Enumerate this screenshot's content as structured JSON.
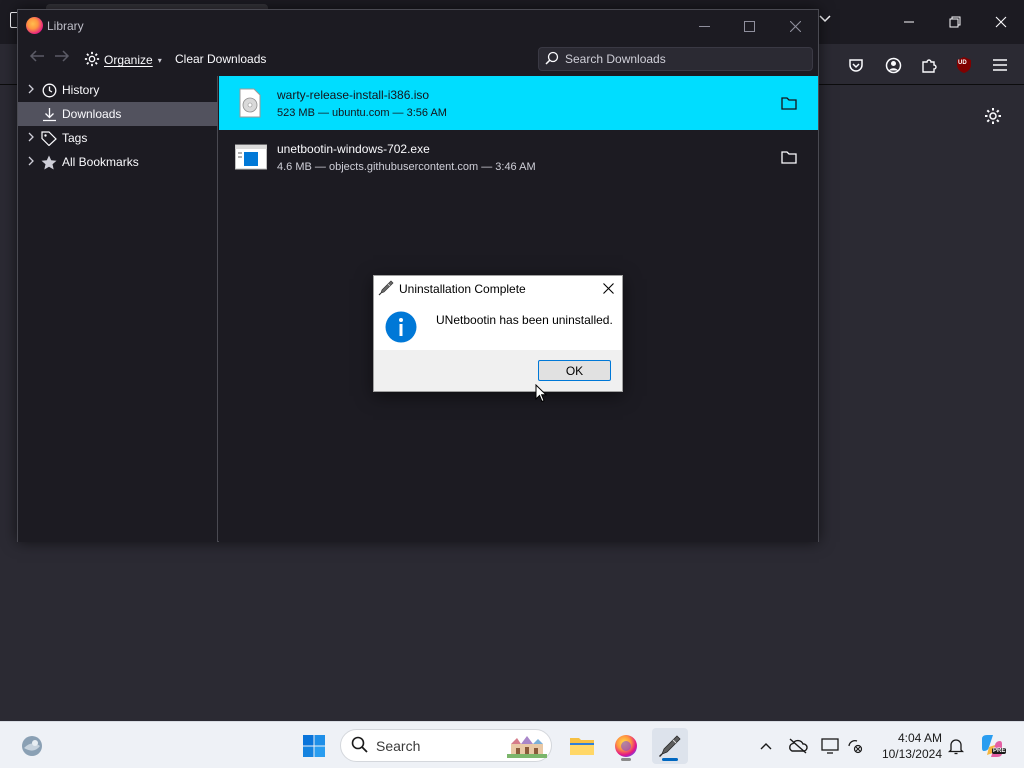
{
  "browser": {
    "toolbar_icons": [
      "pocket-icon",
      "account-icon",
      "extensions-icon",
      "ublock-icon",
      "menu-icon"
    ],
    "ublock_badge": "UD",
    "colors": {
      "background": "#2b2a33",
      "titlebar": "#1c1b22"
    }
  },
  "library": {
    "title": "Library",
    "toolbar": {
      "organize_label": "Organize",
      "clear_downloads_label": "Clear Downloads",
      "search_placeholder": "Search Downloads"
    },
    "sidebar": {
      "items": [
        {
          "label": "History",
          "icon": "clock-icon",
          "expandable": true,
          "selected": false
        },
        {
          "label": "Downloads",
          "icon": "download-icon",
          "expandable": false,
          "selected": true
        },
        {
          "label": "Tags",
          "icon": "tag-icon",
          "expandable": true,
          "selected": false
        },
        {
          "label": "All Bookmarks",
          "icon": "star-icon",
          "expandable": true,
          "selected": false
        }
      ]
    },
    "downloads": [
      {
        "name": "warty-release-install-i386.iso",
        "meta": "523 MB — ubuntu.com — 3:56 AM",
        "icon": "disc-image-icon",
        "selected": true
      },
      {
        "name": "unetbootin-windows-702.exe",
        "meta": "4.6 MB — objects.githubusercontent.com — 3:46 AM",
        "icon": "exe-file-icon",
        "selected": false
      }
    ],
    "colors": {
      "selected_row": "#00ddff",
      "selected_sidebar": "#52525e"
    }
  },
  "dialog": {
    "title": "Uninstallation Complete",
    "message": "UNetbootin has been uninstalled.",
    "ok_label": "OK",
    "icon": "info-icon",
    "colors": {
      "info": "#0078d7",
      "button_border": "#0078d7"
    }
  },
  "taskbar": {
    "search_label": "Search",
    "apps": [
      "widgets-icon",
      "start-icon",
      "file-explorer-icon",
      "firefox-icon",
      "unetbootin-icon"
    ],
    "tray": [
      "chevron-up-icon",
      "onedrive-icon",
      "display-icon",
      "network-icon",
      "bell-icon",
      "copilot-icon"
    ],
    "time": "4:04 AM",
    "date": "10/13/2024",
    "copilot_badge": "PRE"
  }
}
